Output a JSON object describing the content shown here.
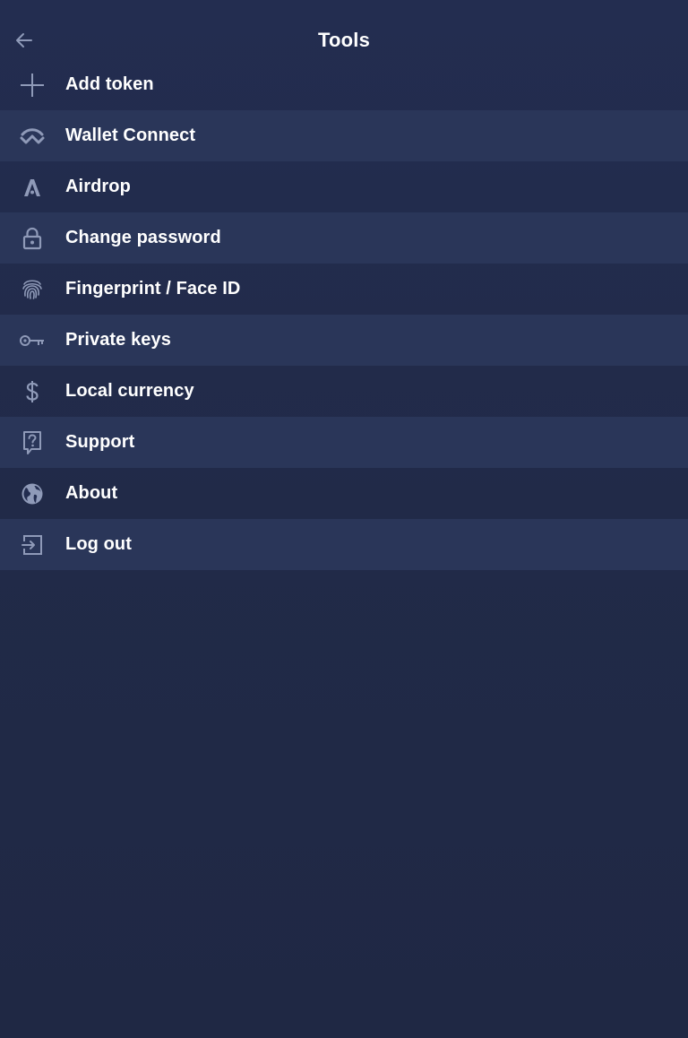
{
  "header": {
    "title": "Tools",
    "back_icon": "arrow-left-icon"
  },
  "colors": {
    "background": "#222b4a",
    "row_alt": "#2a3659",
    "icon": "#8f9ab8",
    "text": "#ffffff"
  },
  "menu": {
    "items": [
      {
        "label": "Add token",
        "icon": "plus-icon"
      },
      {
        "label": "Wallet Connect",
        "icon": "walletconnect-icon"
      },
      {
        "label": "Airdrop",
        "icon": "airdrop-icon"
      },
      {
        "label": "Change password",
        "icon": "lock-icon"
      },
      {
        "label": "Fingerprint / Face ID",
        "icon": "fingerprint-icon"
      },
      {
        "label": "Private keys",
        "icon": "key-icon"
      },
      {
        "label": "Local currency",
        "icon": "dollar-icon"
      },
      {
        "label": "Support",
        "icon": "help-icon"
      },
      {
        "label": "About",
        "icon": "globe-icon"
      },
      {
        "label": "Log out",
        "icon": "logout-icon"
      }
    ]
  }
}
